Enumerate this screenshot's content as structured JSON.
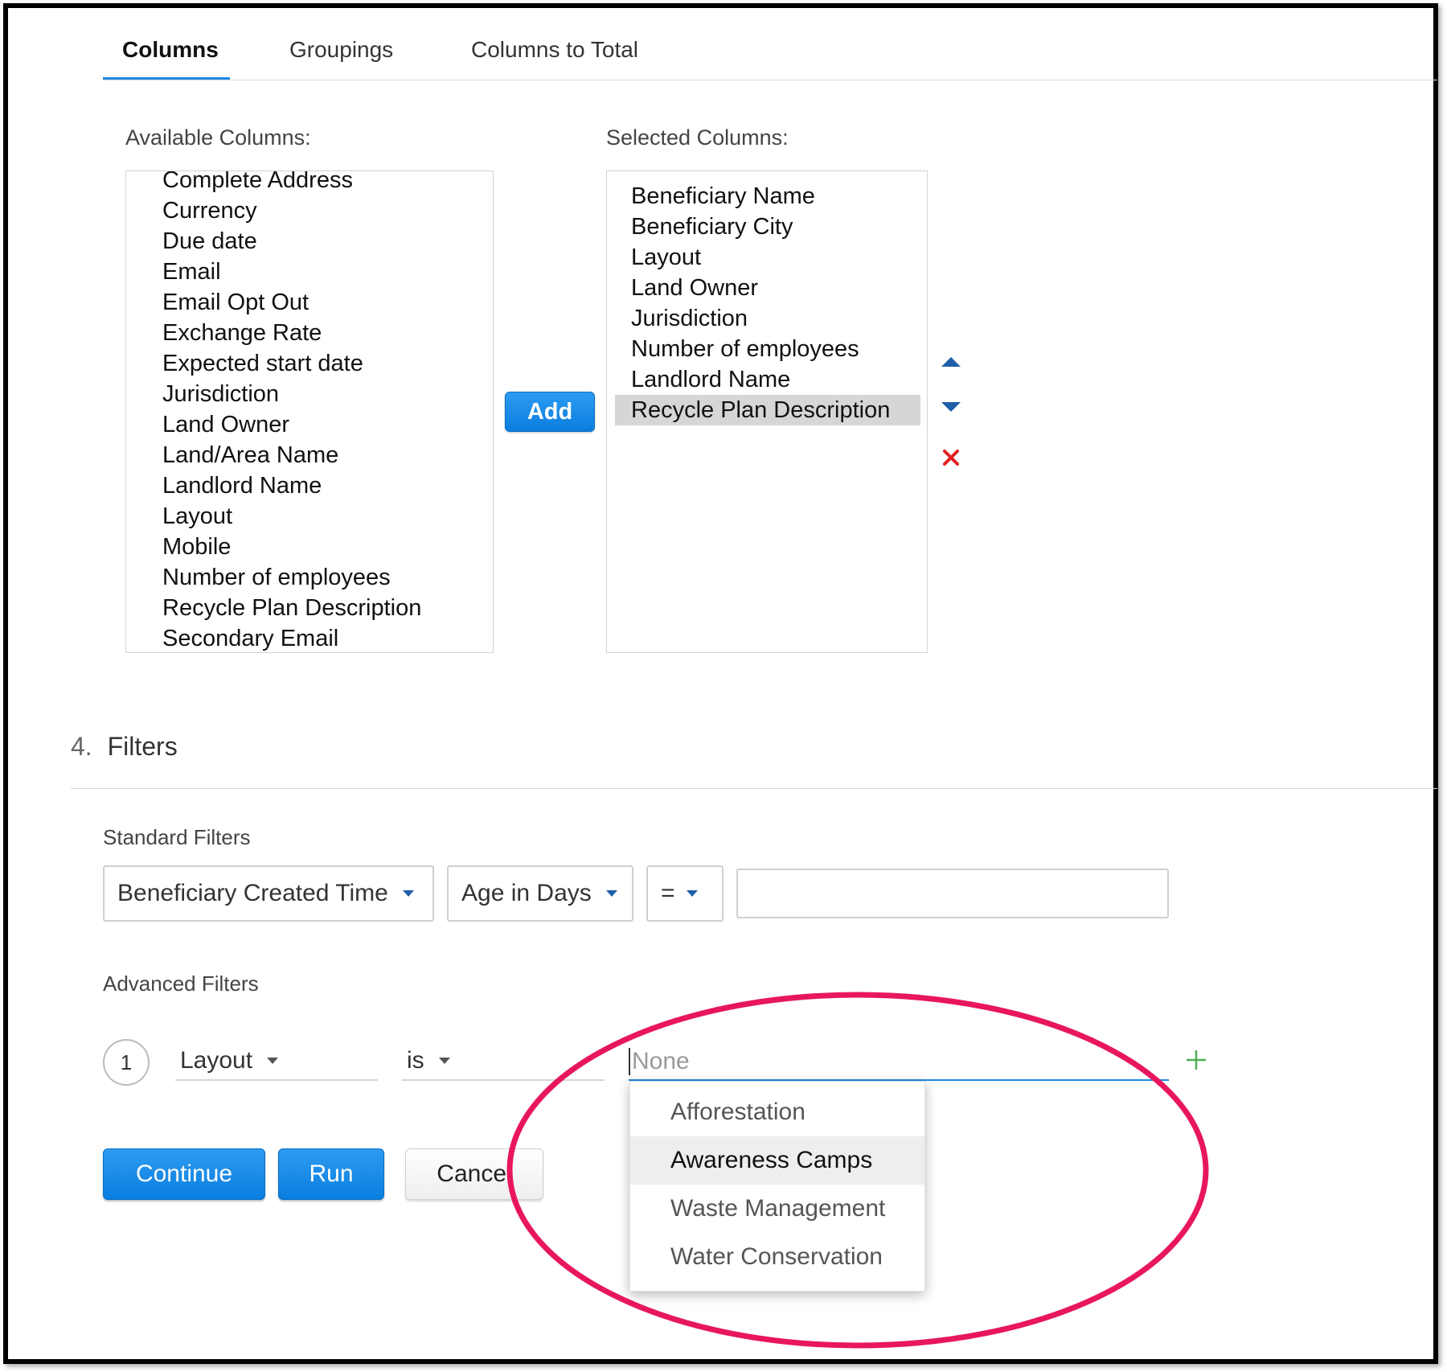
{
  "tabs": [
    {
      "label": "Columns",
      "active": true
    },
    {
      "label": "Groupings",
      "active": false
    },
    {
      "label": "Columns to Total",
      "active": false
    }
  ],
  "columns": {
    "available_label": "Available Columns:",
    "selected_label": "Selected Columns:",
    "available": [
      "Complete Address",
      "Currency",
      "Due date",
      "Email",
      "Email Opt Out",
      "Exchange Rate",
      "Expected start date",
      "Jurisdiction",
      "Land Owner",
      "Land/Area Name",
      "Landlord Name",
      "Layout",
      "Mobile",
      "Number of employees",
      "Recycle Plan Description",
      "Secondary Email"
    ],
    "selected": [
      "Beneficiary Name",
      "Beneficiary City",
      "Layout",
      "Land Owner",
      "Jurisdiction",
      "Number of employees",
      "Landlord Name",
      "Recycle Plan Description"
    ],
    "selected_highlighted": "Recycle Plan Description",
    "add_label": "Add",
    "move_up_icon": "triangle-up-icon",
    "move_down_icon": "triangle-down-icon",
    "remove_icon": "red-x-icon"
  },
  "filters": {
    "number": "4.",
    "title": "Filters",
    "standard_label": "Standard Filters",
    "standard": {
      "field": "Beneficiary Created Time",
      "period": "Age in Days",
      "operator": "=",
      "value": ""
    },
    "advanced_label": "Advanced Filters",
    "advanced": [
      {
        "index": "1",
        "field": "Layout",
        "operator": "is",
        "value_placeholder": "None"
      }
    ],
    "add_icon": "plus-icon",
    "dropdown_options": [
      "Afforestation",
      "Awareness Camps",
      "Waste Management",
      "Water Conservation"
    ],
    "dropdown_hover": "Awareness Camps"
  },
  "actions": {
    "continue_label": "Continue",
    "run_label": "Run",
    "cancel_label": "Cancel"
  },
  "colors": {
    "accent": "#1e88e5",
    "annotation": "#e8175d",
    "remove": "#e02020",
    "add": "#4caf50"
  }
}
